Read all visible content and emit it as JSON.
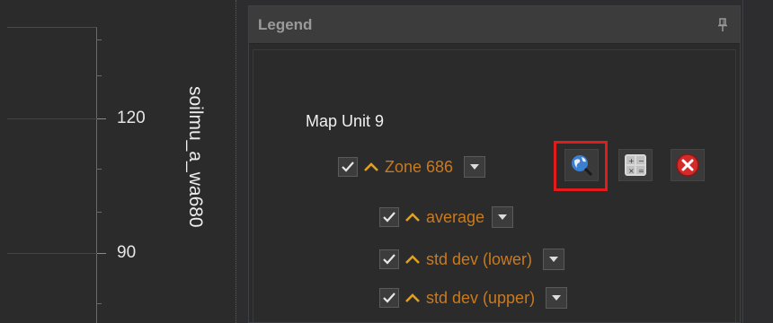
{
  "chart": {
    "y_tick_labels": [
      "120",
      "90"
    ],
    "y_axis_title": "soilmu_a_wa680"
  },
  "legend_panel": {
    "title": "Legend",
    "pin_icon": "pin-icon",
    "map_unit": "Map Unit 9",
    "zone": {
      "label": "Zone 686",
      "checked": true
    },
    "children": [
      {
        "label": "average",
        "checked": true
      },
      {
        "label": "std dev (lower)",
        "checked": true
      },
      {
        "label": "std dev (upper)",
        "checked": true
      }
    ],
    "tools": [
      {
        "name": "globe-zoom-icon",
        "highlighted": true
      },
      {
        "name": "calculator-icon",
        "highlighted": false
      },
      {
        "name": "remove-icon",
        "highlighted": false
      }
    ]
  },
  "colors": {
    "layer_label": "#c97a1e",
    "highlight": "#e21b1b",
    "background": "#2b2b2b",
    "header": "#3c3c3c"
  }
}
